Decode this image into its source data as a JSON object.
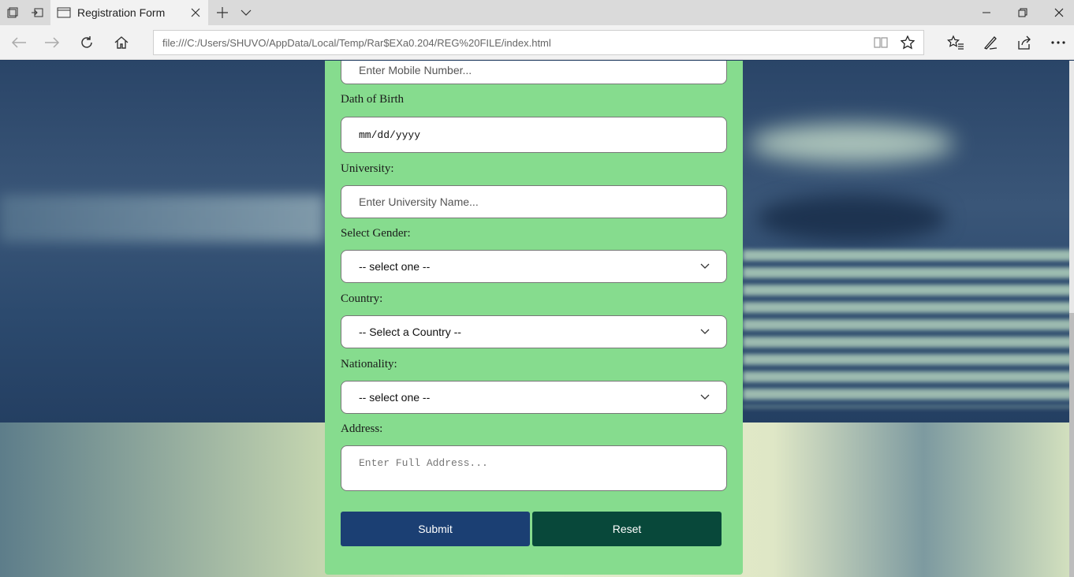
{
  "browser": {
    "tab_title": "Registration Form",
    "url": "file:///C:/Users/SHUVO/AppData/Local/Temp/Rar$EXa0.204/REG%20FILE/index.html"
  },
  "form": {
    "mobile": {
      "placeholder": "Enter Mobile Number..."
    },
    "dob": {
      "label": "Dath of Birth",
      "value": "mm/dd/yyyy"
    },
    "university": {
      "label": "University:",
      "placeholder": "Enter University Name..."
    },
    "gender": {
      "label": "Select Gender:",
      "selected": "-- select one --"
    },
    "country": {
      "label": "Country:",
      "selected": "-- Select a Country --"
    },
    "nationality": {
      "label": "Nationality:",
      "selected": "-- select one --"
    },
    "address": {
      "label": "Address:",
      "placeholder": "Enter Full Address..."
    },
    "submit_label": "Submit",
    "reset_label": "Reset"
  },
  "colors": {
    "form_bg": "#86dc8e",
    "submit_bg": "#1b3f73",
    "reset_bg": "#08483a"
  }
}
